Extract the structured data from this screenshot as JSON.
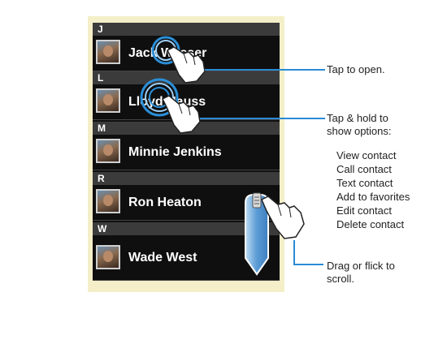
{
  "contacts_screen": {
    "sections": [
      {
        "letter": "J",
        "contact": "Jack Wasser"
      },
      {
        "letter": "L",
        "contact": "Lloyd Nauss"
      },
      {
        "letter": "M",
        "contact": "Minnie Jenkins"
      },
      {
        "letter": "R",
        "contact": "Ron Heaton"
      },
      {
        "letter": "W",
        "contact": "Wade West"
      }
    ]
  },
  "callouts": {
    "tap": "Tap to open.",
    "hold": "Tap & hold to",
    "hold_line2": "show options:",
    "options": [
      "View contact",
      "Call contact",
      "Text contact",
      "Add to favorites",
      "Edit contact",
      "Delete contact"
    ],
    "drag": "Drag or flick to",
    "drag_line2": "scroll."
  },
  "colors": {
    "list_background": "#111111",
    "header_background": "#3b3b3b",
    "frame": "#f4efc9",
    "scroll_handle": "#5b9bd5",
    "touch_ring": "#2b8fd8",
    "callout_line": "#2a8bd6"
  }
}
